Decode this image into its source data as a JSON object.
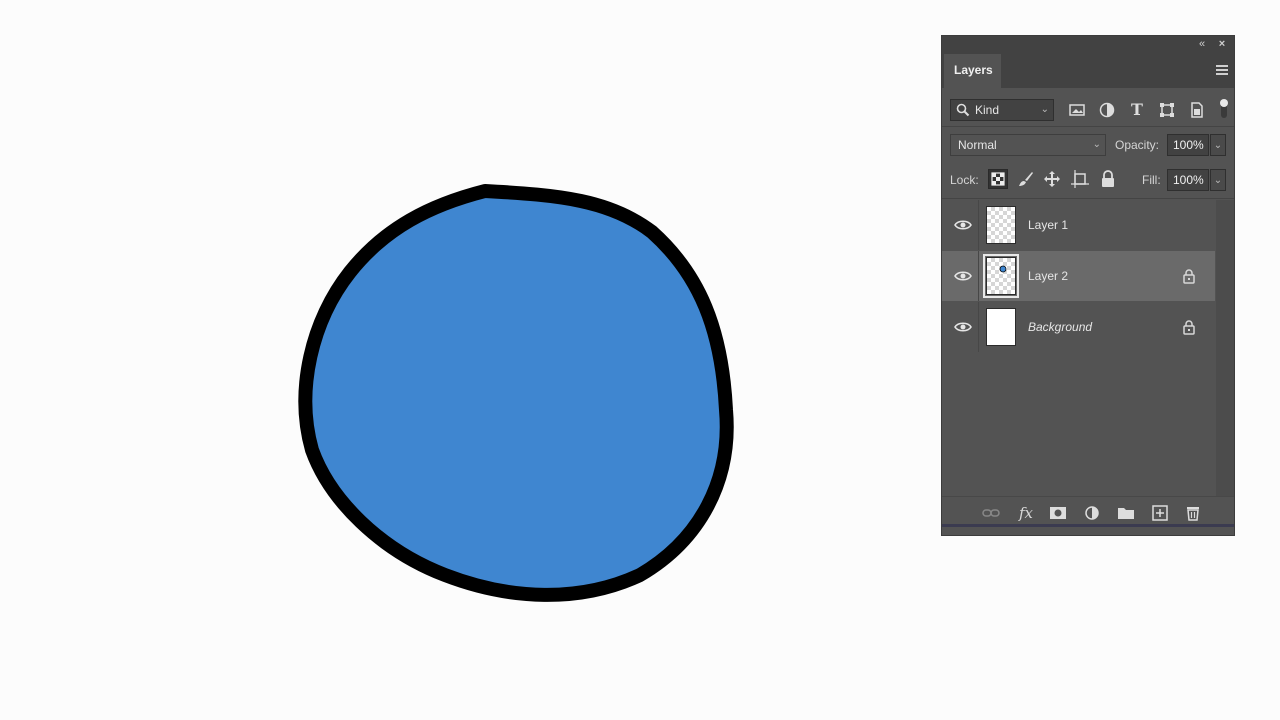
{
  "canvas": {
    "fill_color": "#3f86d0",
    "stroke_color": "#000000"
  },
  "panel": {
    "tab_label": "Layers",
    "collapse_label": "«",
    "close_label": "×",
    "filter": {
      "kind_label": "Kind",
      "icons": [
        "image-filter-icon",
        "adjustment-filter-icon",
        "type-filter-icon",
        "shape-filter-icon",
        "smart-object-filter-icon"
      ],
      "type_glyph": "T"
    },
    "blend_mode": "Normal",
    "opacity_label": "Opacity:",
    "opacity_value": "100%",
    "lock_label": "Lock:",
    "fill_label": "Fill:",
    "fill_value": "100%",
    "layers": [
      {
        "name": "Layer 1",
        "visible": true,
        "locked": false,
        "selected": false,
        "thumb": "transparent"
      },
      {
        "name": "Layer 2",
        "visible": true,
        "locked": true,
        "selected": true,
        "thumb": "transparent"
      },
      {
        "name": "Background",
        "visible": true,
        "locked": true,
        "selected": false,
        "thumb": "white"
      }
    ],
    "bottom_icons": [
      "link-layers-icon",
      "fx-icon",
      "add-mask-icon",
      "adjustment-layer-icon",
      "group-folder-icon",
      "new-layer-icon",
      "trash-icon"
    ],
    "fx_label": "fx"
  }
}
